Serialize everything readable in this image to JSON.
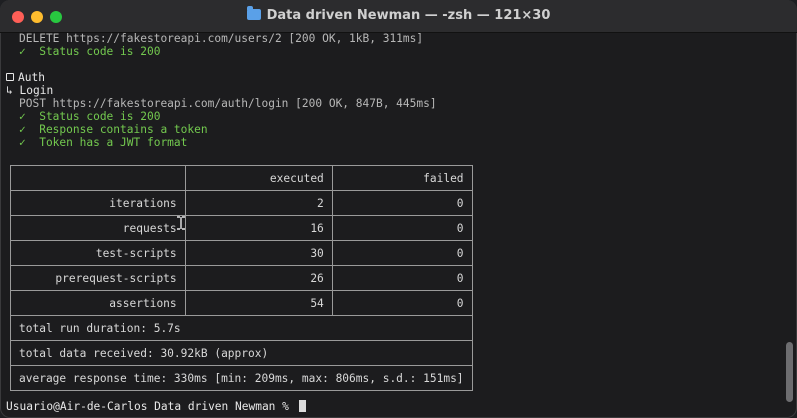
{
  "window": {
    "title": "Data driven Newman — -zsh — 121×30",
    "folder_icon": "folder-icon"
  },
  "log": {
    "delete_request": "DELETE https://fakestoreapi.com/users/2 [200 OK, 1kB, 311ms]",
    "delete_check": "✓  Status code is 200",
    "folder_name": "Auth",
    "request_prefix": "↳",
    "request_name": "Login",
    "post_request": "POST https://fakestoreapi.com/auth/login [200 OK, 847B, 445ms]",
    "checks": [
      "✓  Status code is 200",
      "✓  Response contains a token",
      "✓  Token has a JWT format"
    ]
  },
  "summary": {
    "headers": [
      "",
      "executed",
      "failed"
    ],
    "rows": [
      {
        "label": "iterations",
        "executed": "2",
        "failed": "0"
      },
      {
        "label": "requests",
        "executed": "16",
        "failed": "0"
      },
      {
        "label": "test-scripts",
        "executed": "30",
        "failed": "0"
      },
      {
        "label": "prerequest-scripts",
        "executed": "26",
        "failed": "0"
      },
      {
        "label": "assertions",
        "executed": "54",
        "failed": "0"
      }
    ],
    "duration": "total run duration: 5.7s",
    "data_received": "total data received: 30.92kB (approx)",
    "response_time": "average response time: 330ms [min: 209ms, max: 806ms, s.d.: 151ms]"
  },
  "prompt": {
    "text": "Usuario@Air-de-Carlos Data driven Newman % "
  },
  "colors": {
    "green": "#73c94f",
    "background": "#1c1c1e"
  }
}
